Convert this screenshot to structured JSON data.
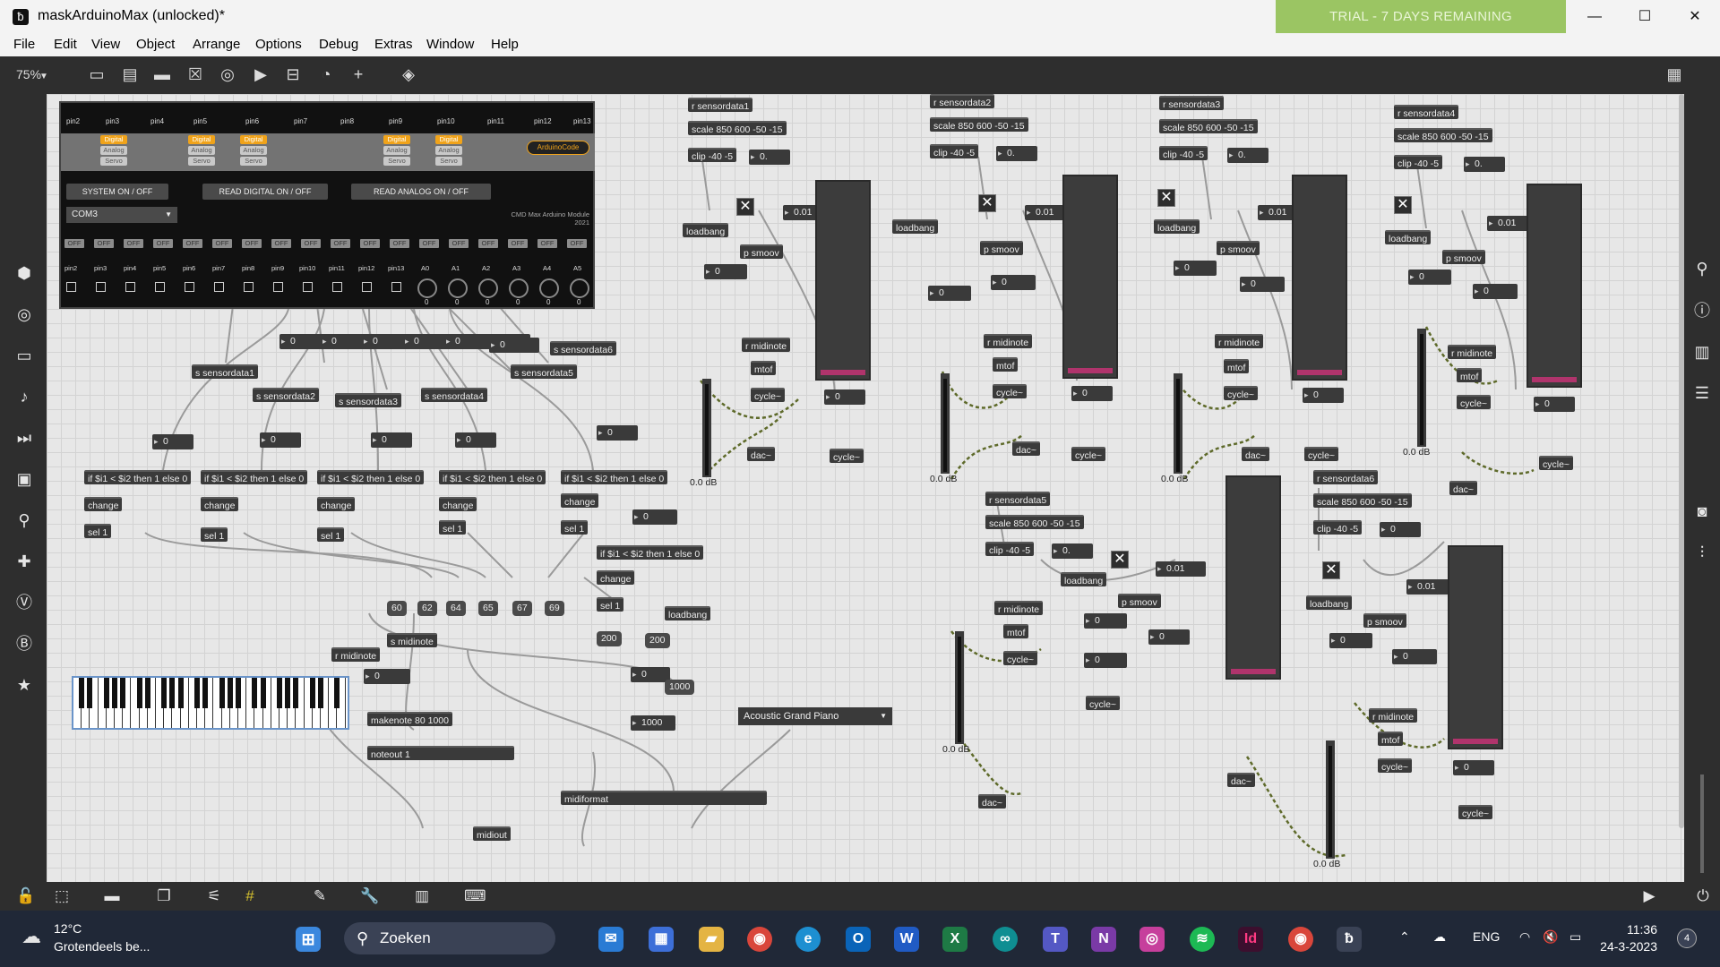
{
  "window": {
    "title": "maskArduinoMax (unlocked)*",
    "trial": "TRIAL - 7 DAYS REMAINING",
    "minimize": "—",
    "maximize": "☐",
    "close": "✕"
  },
  "menubar": [
    "File",
    "Edit",
    "View",
    "Object",
    "Arrange",
    "Options",
    "Debug",
    "Extras",
    "Window",
    "Help"
  ],
  "toolbar": {
    "zoom": "75%"
  },
  "arduino": {
    "pins_top": [
      "pin2",
      "pin3",
      "pin4",
      "pin5",
      "pin6",
      "pin7",
      "pin8",
      "pin9",
      "pin10",
      "pin11",
      "pin12",
      "pin13"
    ],
    "mode_digital": "Digital",
    "mode_analog": "Analog",
    "mode_servo": "Servo",
    "arduino_code": "ArduinoCode",
    "system_btn": "SYSTEM ON / OFF",
    "read_digital": "READ DIGITAL  ON / OFF",
    "read_analog": "READ ANALOG  ON / OFF",
    "port": "COM3",
    "module_line1": "CMD Max Arduino Module",
    "module_line2": "2021",
    "off": "OFF",
    "pins_bottom": [
      "pin2",
      "pin3",
      "pin4",
      "pin5",
      "pin6",
      "pin7",
      "pin8",
      "pin9",
      "pin10",
      "pin11",
      "pin12",
      "pin13",
      "A0",
      "A1",
      "A2",
      "A3",
      "A4",
      "A5"
    ],
    "dial_value": "0"
  },
  "labels": {
    "s_sensordata1": "s sensordata1",
    "s_sensordata2": "s sensordata2",
    "s_sensordata3": "s sensordata3",
    "s_sensordata4": "s sensordata4",
    "s_sensordata5": "s sensordata5",
    "s_sensordata6": "s sensordata6",
    "if_expr": "if $i1 < $i2 then 1 else 0",
    "change": "change",
    "sel1": "sel 1",
    "zero": "0",
    "zero_dot": "0.",
    "s_midinote": "s midinote",
    "r_midinote": "r midinote",
    "loadbang": "loadbang",
    "makenote": "makenote 80 1000",
    "noteout": "noteout 1",
    "midiformat": "midiformat",
    "midiout": "midiout",
    "instrument": "Acoustic Grand Piano",
    "v200": "200",
    "v1000": "1000",
    "r_sensordata1": "r sensordata1",
    "r_sensordata2": "r sensordata2",
    "r_sensordata3": "r sensordata3",
    "r_sensordata4": "r sensordata4",
    "r_sensordata5": "r sensordata5",
    "r_sensordata6": "r sensordata6",
    "scale": "scale 850 600 -50 -15",
    "clip": "clip -40 -5",
    "smoov": "smoov",
    "v001": "0.01",
    "mtof": "mtof",
    "cycle": "cycle~",
    "dac": "dac~",
    "db": "0.0 dB",
    "p": "p"
  },
  "notes": [
    "60",
    "62",
    "64",
    "65",
    "67",
    "69"
  ],
  "taskbar": {
    "temp": "12°C",
    "weather": "Grotendeels be...",
    "search": "Zoeken",
    "lang": "ENG",
    "time": "11:36",
    "date": "24-3-2023",
    "badge": "4"
  },
  "colors": {
    "trial_bg": "#9bc563",
    "meter_bar": "#b0346c",
    "digital": "#f0a31a",
    "piano_border": "#6a94c9"
  }
}
